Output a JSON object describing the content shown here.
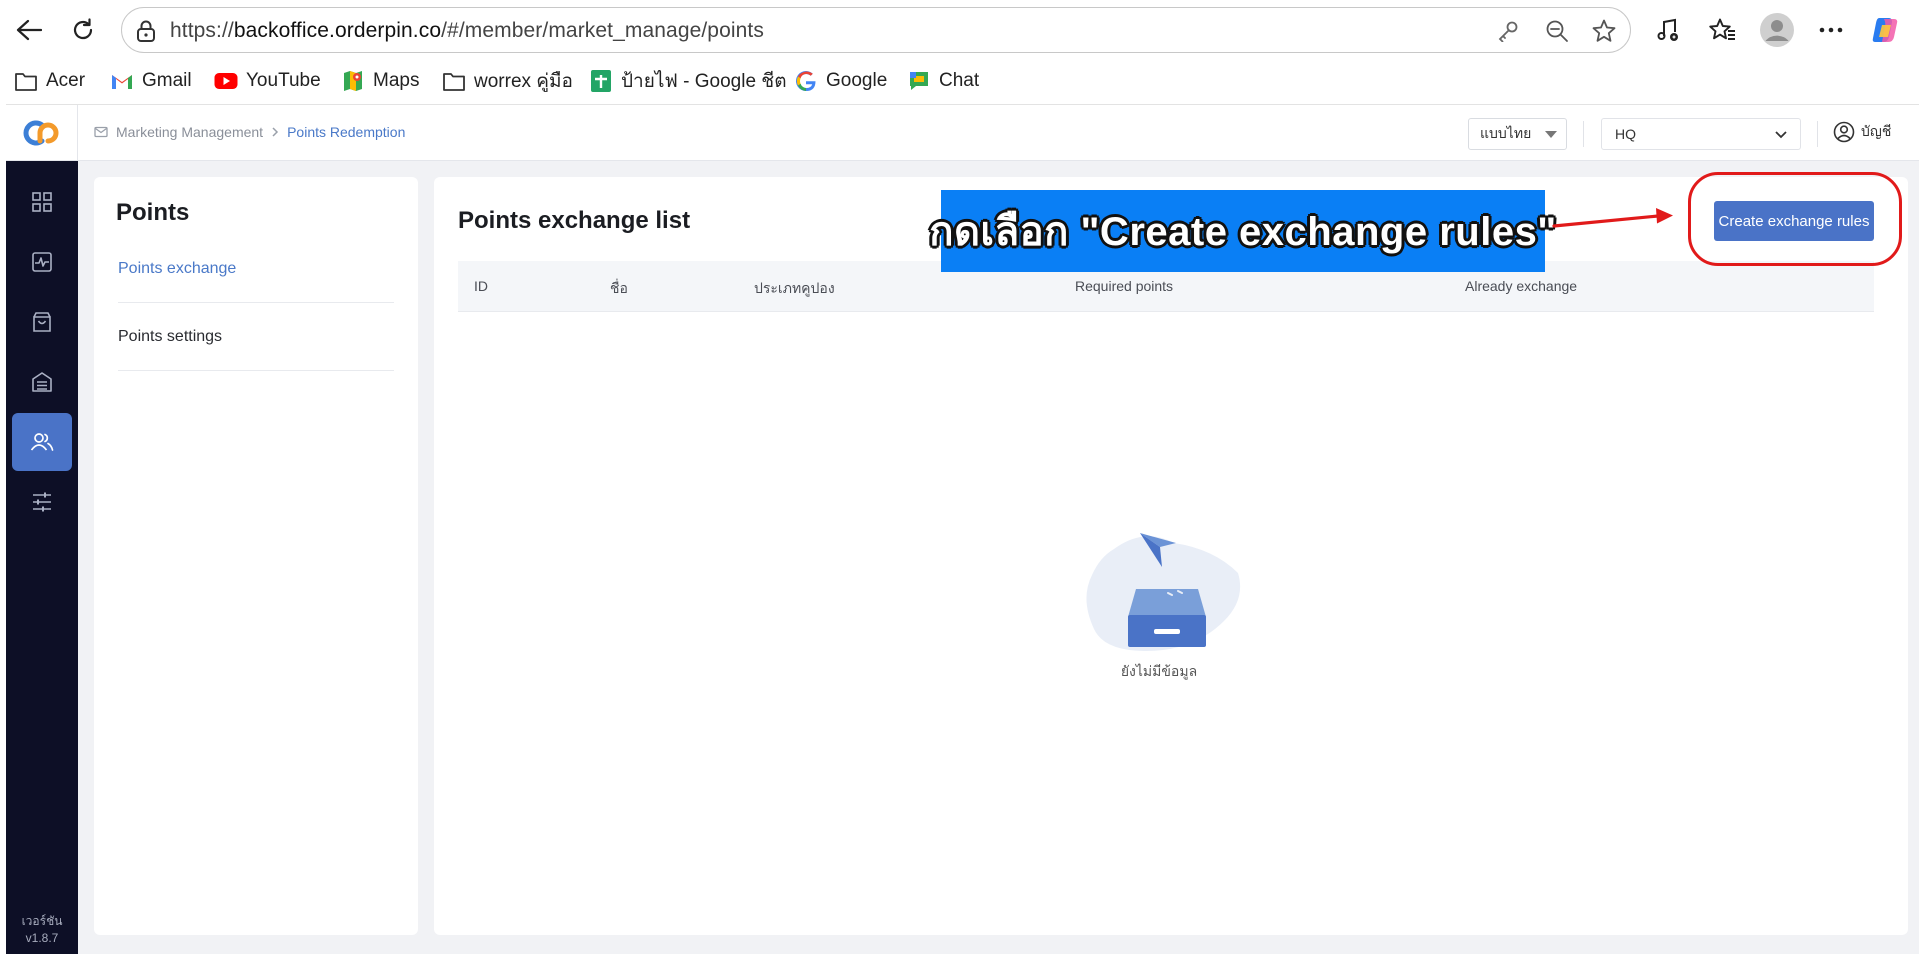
{
  "browser": {
    "url_prefix": "https://",
    "url_domain": "backoffice.orderpin.co",
    "url_path": "/#/member/market_manage/points",
    "icons": [
      "back-icon",
      "reload-icon",
      "lock-icon",
      "key-icon",
      "zoom-out-icon",
      "star-icon",
      "media-icon",
      "favorites-icon",
      "profile-avatar",
      "more-icon",
      "copilot-icon"
    ]
  },
  "bookmarks": [
    {
      "label": "Acer",
      "icon": "folder-icon"
    },
    {
      "label": "Gmail",
      "icon": "gmail-icon"
    },
    {
      "label": "YouTube",
      "icon": "youtube-icon"
    },
    {
      "label": "Maps",
      "icon": "maps-icon"
    },
    {
      "label": "worrex คู่มือ",
      "icon": "folder-icon"
    },
    {
      "label": "ป้ายไฟ - Google ชีต",
      "icon": "sheets-icon"
    },
    {
      "label": "Google",
      "icon": "google-icon"
    },
    {
      "label": "Chat",
      "icon": "chat-icon"
    }
  ],
  "header": {
    "breadcrumb_root": "Marketing Management",
    "breadcrumb_current": "Points Redemption",
    "language": "แบบไทย",
    "shop": "HQ",
    "account": "บัญชี"
  },
  "sidebar": {
    "items": [
      "dashboard-icon",
      "activity-icon",
      "shopping-bag-icon",
      "store-icon",
      "members-icon",
      "settings-sliders-icon"
    ],
    "active_index": 4,
    "version_label": "เวอร์ชัน",
    "version": "v1.8.7"
  },
  "left_panel": {
    "title": "Points",
    "items": [
      {
        "label": "Points exchange",
        "active": true
      },
      {
        "label": "Points settings",
        "active": false
      }
    ]
  },
  "main": {
    "title": "Points exchange list",
    "create_button": "Create exchange rules",
    "columns": [
      "ID",
      "ชื่อ",
      "ประเภทคูปอง",
      "Required points",
      "Already exchange"
    ],
    "empty_text": "ยังไม่มีข้อมูล"
  },
  "annotation": {
    "text": "กดเลือก \"Create exchange rules\"",
    "banner_color": "#0a7ff5",
    "ring_color": "#e11a1a"
  },
  "colors": {
    "accent": "#4a73c7",
    "sidebar_bg": "#0d0f26",
    "link": "#4a79c8"
  }
}
